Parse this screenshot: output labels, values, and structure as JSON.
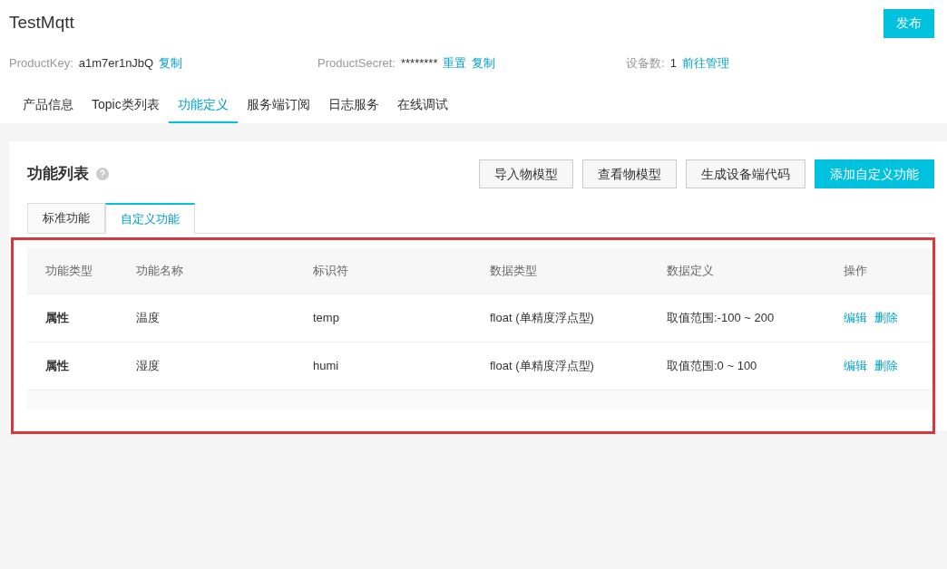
{
  "header": {
    "title": "TestMqtt",
    "publish_button": "发布"
  },
  "info": [
    {
      "label": "ProductKey:",
      "value": "a1m7er1nJbQ",
      "links": [
        "复制"
      ]
    },
    {
      "label": "ProductSecret:",
      "value": "********",
      "links": [
        "重置",
        "复制"
      ]
    },
    {
      "label": "设备数:",
      "value": "1",
      "links": [
        "前往管理"
      ]
    }
  ],
  "tabs": [
    {
      "label": "产品信息",
      "selected": false
    },
    {
      "label": "Topic类列表",
      "selected": false
    },
    {
      "label": "功能定义",
      "selected": true
    },
    {
      "label": "服务端订阅",
      "selected": false
    },
    {
      "label": "日志服务",
      "selected": false
    },
    {
      "label": "在线调试",
      "selected": false
    }
  ],
  "card": {
    "title": "功能列表",
    "buttons": [
      {
        "label": "导入物模型",
        "primary": false
      },
      {
        "label": "查看物模型",
        "primary": false
      },
      {
        "label": "生成设备端代码",
        "primary": false
      },
      {
        "label": "添加自定义功能",
        "primary": true
      }
    ],
    "subtabs": [
      {
        "label": "标准功能",
        "selected": false
      },
      {
        "label": "自定义功能",
        "selected": true
      }
    ],
    "table": {
      "columns": [
        "功能类型",
        "功能名称",
        "标识符",
        "数据类型",
        "数据定义",
        "操作"
      ],
      "rows": [
        {
          "cells": [
            "属性",
            "温度",
            "temp",
            "float (单精度浮点型)",
            "取值范围:-100 ~ 200"
          ],
          "actions": [
            "编辑",
            "删除"
          ]
        },
        {
          "cells": [
            "属性",
            "湿度",
            "humi",
            "float (单精度浮点型)",
            "取值范围:0 ~ 100"
          ],
          "actions": [
            "编辑",
            "删除"
          ]
        }
      ]
    }
  }
}
